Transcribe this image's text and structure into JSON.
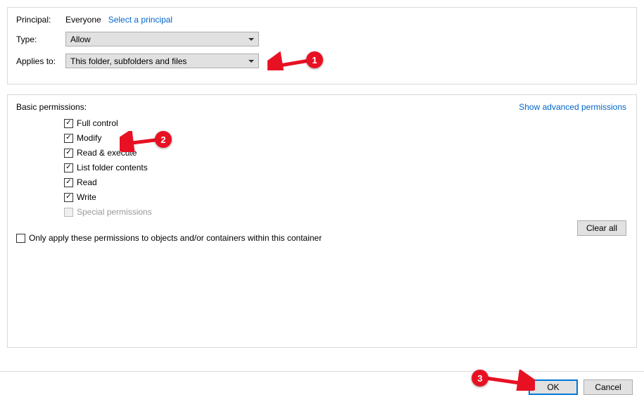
{
  "top": {
    "principal_label": "Principal:",
    "principal_value": "Everyone",
    "select_principal_link": "Select a principal",
    "type_label": "Type:",
    "type_value": "Allow",
    "applies_label": "Applies to:",
    "applies_value": "This folder, subfolders and files"
  },
  "permissions": {
    "section_label": "Basic permissions:",
    "advanced_link": "Show advanced permissions",
    "items": [
      {
        "label": "Full control",
        "checked": true,
        "disabled": false
      },
      {
        "label": "Modify",
        "checked": true,
        "disabled": false
      },
      {
        "label": "Read & execute",
        "checked": true,
        "disabled": false
      },
      {
        "label": "List folder contents",
        "checked": true,
        "disabled": false
      },
      {
        "label": "Read",
        "checked": true,
        "disabled": false
      },
      {
        "label": "Write",
        "checked": true,
        "disabled": false
      },
      {
        "label": "Special permissions",
        "checked": false,
        "disabled": true
      }
    ],
    "only_apply_label": "Only apply these permissions to objects and/or containers within this container",
    "only_apply_checked": false,
    "clear_all_label": "Clear all"
  },
  "buttons": {
    "ok": "OK",
    "cancel": "Cancel"
  },
  "annotations": {
    "colors": {
      "red": "#e81123"
    },
    "badge1": "1",
    "badge2": "2",
    "badge3": "3"
  }
}
